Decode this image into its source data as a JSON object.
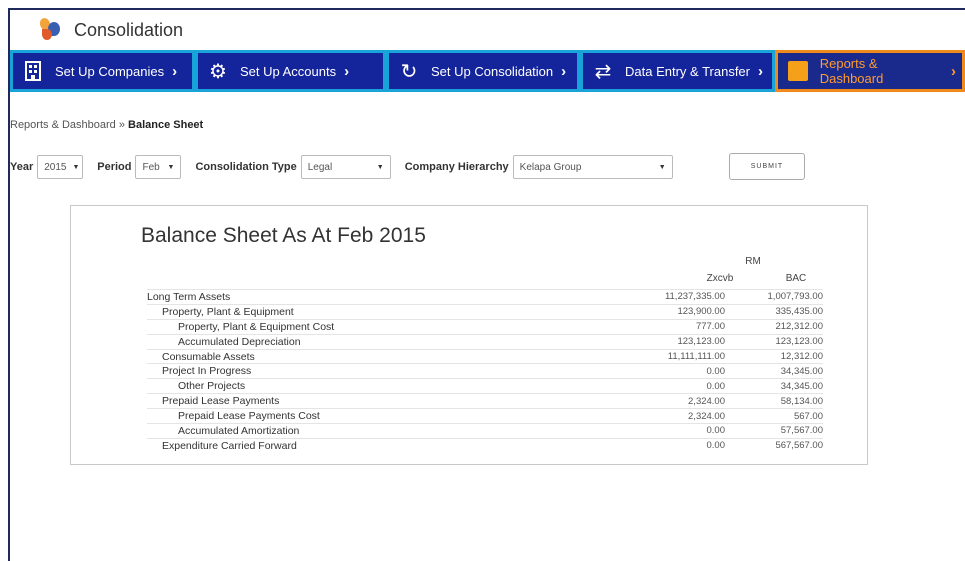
{
  "app": {
    "title": "Consolidation"
  },
  "nav": [
    {
      "label": "Set Up Companies",
      "icon": "building-icon"
    },
    {
      "label": "Set Up Accounts",
      "icon": "gears-icon"
    },
    {
      "label": "Set Up Consolidation",
      "icon": "cycle-icon"
    },
    {
      "label": "Data Entry & Transfer",
      "icon": "transfer-arrows-icon"
    },
    {
      "label": "Reports & Dashboard",
      "icon": "report-icon",
      "active": true
    }
  ],
  "breadcrumb": {
    "parent": "Reports & Dashboard",
    "separator": " » ",
    "current": "Balance Sheet"
  },
  "filters": {
    "year_label": "Year",
    "year_value": "2015",
    "period_label": "Period",
    "period_value": "Feb",
    "type_label": "Consolidation Type",
    "type_value": "Legal",
    "hierarchy_label": "Company Hierarchy",
    "hierarchy_value": "Kelapa Group",
    "submit_label": "SUBMIT"
  },
  "report": {
    "title": "Balance Sheet As At Feb 2015",
    "currency": "RM",
    "columns": [
      "Zxcvb",
      "BAC"
    ],
    "rows": [
      {
        "label": "Long Term Assets",
        "level": 0,
        "v1": "11,237,335.00",
        "v2": "1,007,793.00"
      },
      {
        "label": "Property, Plant & Equipment",
        "level": 1,
        "v1": "123,900.00",
        "v2": "335,435.00"
      },
      {
        "label": "Property, Plant & Equipment Cost",
        "level": 2,
        "v1": "777.00",
        "v2": "212,312.00"
      },
      {
        "label": "Accumulated Depreciation",
        "level": 2,
        "v1": "123,123.00",
        "v2": "123,123.00"
      },
      {
        "label": "Consumable Assets",
        "level": 1,
        "v1": "11,111,111.00",
        "v2": "12,312.00"
      },
      {
        "label": "Project In Progress",
        "level": 1,
        "v1": "0.00",
        "v2": "34,345.00"
      },
      {
        "label": "Other Projects",
        "level": 2,
        "v1": "0.00",
        "v2": "34,345.00"
      },
      {
        "label": "Prepaid Lease Payments",
        "level": 1,
        "v1": "2,324.00",
        "v2": "58,134.00"
      },
      {
        "label": "Prepaid Lease Payments Cost",
        "level": 2,
        "v1": "2,324.00",
        "v2": "567.00"
      },
      {
        "label": "Accumulated Amortization",
        "level": 2,
        "v1": "0.00",
        "v2": "57,567.00"
      },
      {
        "label": "Expenditure Carried Forward",
        "level": 1,
        "v1": "0.00",
        "v2": "567,567.00"
      }
    ]
  }
}
